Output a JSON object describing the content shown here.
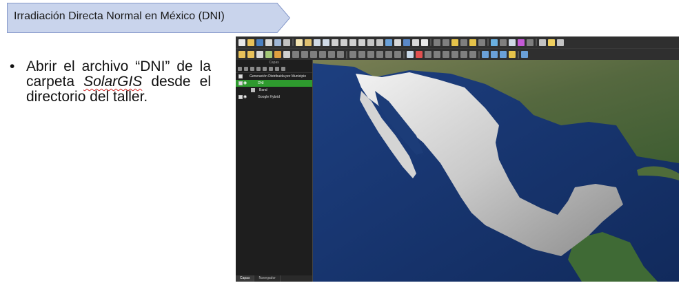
{
  "slide": {
    "title": "Irradiación Directa Normal en México (DNI)",
    "bullet_marker": "•",
    "bullet_text_1": "Abrir el archivo “DNI” de la carpeta ",
    "bullet_text_emphasis": "SolarGIS",
    "bullet_text_2": " desde el directorio del taller."
  },
  "colors": {
    "banner_fill": "#c9d4ec",
    "banner_stroke": "#8497c9",
    "selected_layer": "#2e9a2e",
    "ocean": "#17346e",
    "land": "#5a6e45",
    "mexico_raster": "#d8d8d8"
  },
  "qgis": {
    "layers_panel_title": "Capas",
    "layers": [
      {
        "name": "Generación Distribuida por Municipio",
        "checked": true,
        "selected": false
      },
      {
        "name": "DNI",
        "checked": true,
        "selected": true
      },
      {
        "name": "Band",
        "checked": false,
        "selected": false
      },
      {
        "name": "Google Hybrid",
        "checked": true,
        "selected": false
      }
    ],
    "bottom_tabs": [
      "Capas",
      "Navegador"
    ]
  }
}
